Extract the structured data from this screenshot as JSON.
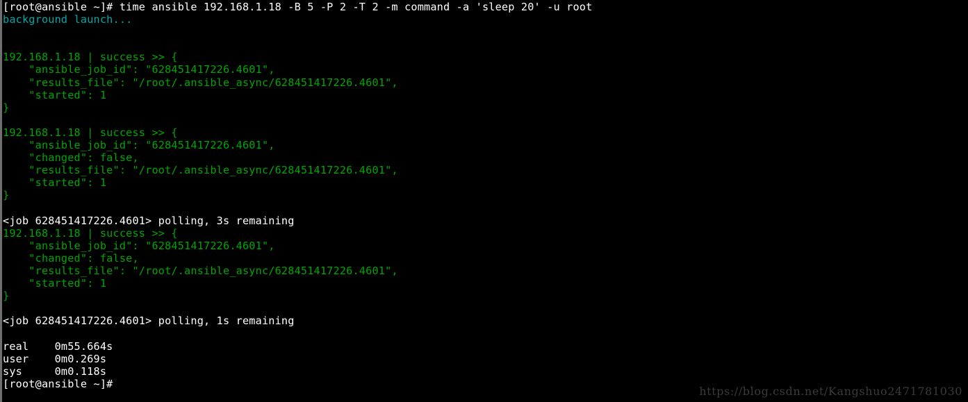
{
  "terminal": {
    "title": "root@ansible:~",
    "background_color": "#000000",
    "prompt": "[root@ansible ~]#",
    "colors": {
      "white": "#ffffff",
      "green": "#00a500",
      "cyan": "#00a8a8",
      "watermark": "#3a3a3a",
      "left_edge": "#6f6f6f"
    },
    "command": "time ansible 192.168.1.18 -B 5 -P 2 -T 2 -m command -a 'sleep 20' -u root",
    "job_id": "628451417226.4601",
    "host": "192.168.1.18",
    "results_file": "/root/.ansible_async/628451417226.4601",
    "timing": {
      "real": "0m55.664s",
      "user": "0m0.269s",
      "sys": "0m0.118s"
    },
    "lines": [
      {
        "color": "white",
        "text": "[root@ansible ~]# time ansible 192.168.1.18 -B 5 -P 2 -T 2 -m command -a 'sleep 20' -u root"
      },
      {
        "color": "cyan",
        "text": "background launch..."
      },
      {
        "color": "white",
        "text": ""
      },
      {
        "color": "white",
        "text": ""
      },
      {
        "color": "green",
        "text": "192.168.1.18 | success >> {"
      },
      {
        "color": "green",
        "text": "    \"ansible_job_id\": \"628451417226.4601\","
      },
      {
        "color": "green",
        "text": "    \"results_file\": \"/root/.ansible_async/628451417226.4601\","
      },
      {
        "color": "green",
        "text": "    \"started\": 1"
      },
      {
        "color": "green",
        "text": "}"
      },
      {
        "color": "white",
        "text": ""
      },
      {
        "color": "green",
        "text": "192.168.1.18 | success >> {"
      },
      {
        "color": "green",
        "text": "    \"ansible_job_id\": \"628451417226.4601\","
      },
      {
        "color": "green",
        "text": "    \"changed\": false,"
      },
      {
        "color": "green",
        "text": "    \"results_file\": \"/root/.ansible_async/628451417226.4601\","
      },
      {
        "color": "green",
        "text": "    \"started\": 1"
      },
      {
        "color": "green",
        "text": "}"
      },
      {
        "color": "white",
        "text": ""
      },
      {
        "color": "white",
        "text": "<job 628451417226.4601> polling, 3s remaining"
      },
      {
        "color": "green",
        "text": "192.168.1.18 | success >> {"
      },
      {
        "color": "green",
        "text": "    \"ansible_job_id\": \"628451417226.4601\","
      },
      {
        "color": "green",
        "text": "    \"changed\": false,"
      },
      {
        "color": "green",
        "text": "    \"results_file\": \"/root/.ansible_async/628451417226.4601\","
      },
      {
        "color": "green",
        "text": "    \"started\": 1"
      },
      {
        "color": "green",
        "text": "}"
      },
      {
        "color": "white",
        "text": ""
      },
      {
        "color": "white",
        "text": "<job 628451417226.4601> polling, 1s remaining"
      },
      {
        "color": "white",
        "text": ""
      },
      {
        "color": "white",
        "text": "real    0m55.664s"
      },
      {
        "color": "white",
        "text": "user    0m0.269s"
      },
      {
        "color": "white",
        "text": "sys     0m0.118s"
      },
      {
        "color": "white",
        "text": "[root@ansible ~]#"
      }
    ]
  },
  "watermark": {
    "text": "https://blog.csdn.net/Kangshuo2471781030"
  }
}
